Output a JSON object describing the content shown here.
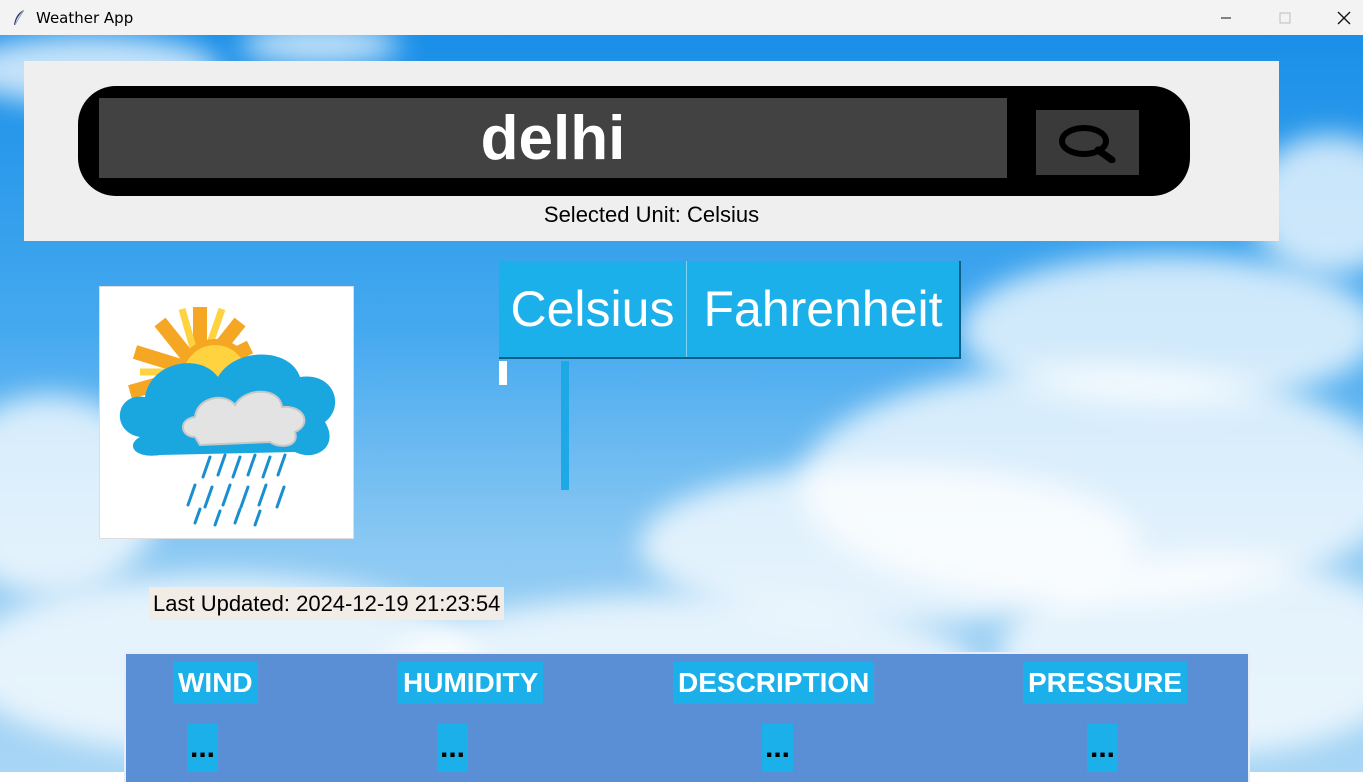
{
  "window": {
    "title": "Weather App",
    "app_icon": "feather-icon",
    "controls": [
      "minimize-icon",
      "maximize-icon",
      "close-icon"
    ]
  },
  "search": {
    "value": "delhi",
    "button_icon": "search-icon"
  },
  "unit": {
    "selected_label": "Selected Unit: Celsius",
    "options": [
      "Celsius",
      "Fahrenheit"
    ]
  },
  "weather": {
    "icon": "sun-cloud-rain-icon",
    "last_updated": "Last Updated: 2024-12-19 21:23:54"
  },
  "details": [
    {
      "label": "WIND",
      "value": "..."
    },
    {
      "label": "HUMIDITY",
      "value": "..."
    },
    {
      "label": "DESCRIPTION",
      "value": "..."
    },
    {
      "label": "PRESSURE",
      "value": "..."
    }
  ],
  "colors": {
    "accent": "#1bb0ea",
    "panel": "#5a8fd6",
    "search_bg": "#424242"
  }
}
